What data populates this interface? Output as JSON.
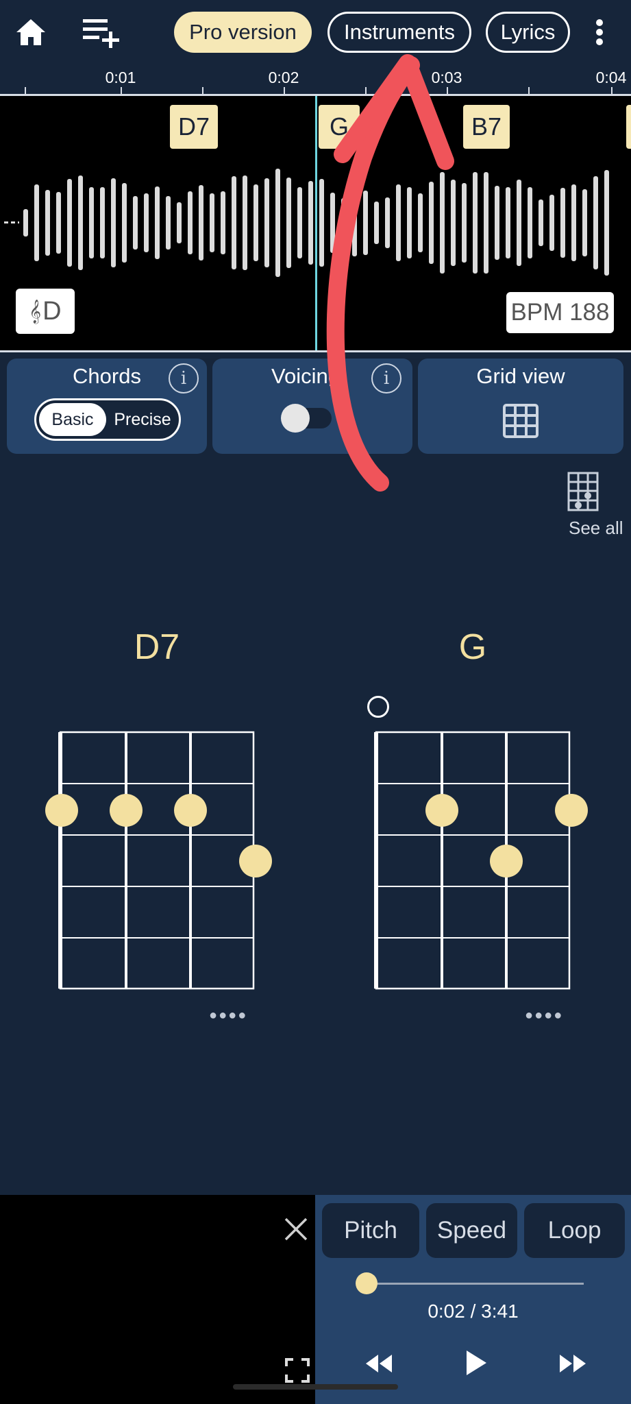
{
  "toolbar": {
    "home_icon": "home-icon",
    "add_playlist_icon": "playlist-add-icon",
    "pro_label": "Pro version",
    "instruments_label": "Instruments",
    "lyrics_label": "Lyrics",
    "menu_icon": "more-vert-icon"
  },
  "timeline": {
    "ticks": [
      "0:01",
      "0:02",
      "0:03",
      "0:04"
    ]
  },
  "waveform": {
    "chords": [
      "D7",
      "G",
      "B7"
    ],
    "key_symbol": "𝄞",
    "key": "D",
    "bpm_label": "BPM 188",
    "playhead_color": "#6fd6e0"
  },
  "controls": {
    "chords_title": "Chords",
    "basic_label": "Basic",
    "precise_label": "Precise",
    "voicing_title": "Voicing",
    "voicing_on": false,
    "grid_title": "Grid view",
    "info_label": "i",
    "see_all_label": "See all"
  },
  "diagrams": [
    {
      "name": "D7",
      "open_strings": []
    },
    {
      "name": "G",
      "open_strings": [
        "string-1"
      ]
    }
  ],
  "player": {
    "close_icon": "close-icon",
    "fullscreen_icon": "fullscreen-icon",
    "pitch_label": "Pitch",
    "speed_label": "Speed",
    "loop_label": "Loop",
    "time_label": "0:02 / 3:41",
    "progress": 0.009,
    "rewind_icon": "rewind-icon",
    "play_icon": "play-icon",
    "forward_icon": "fast-forward-icon"
  },
  "colors": {
    "background": "#16253a",
    "card": "#26446a",
    "accent": "#f6e8b6",
    "annotation_arrow": "#f0545a"
  }
}
